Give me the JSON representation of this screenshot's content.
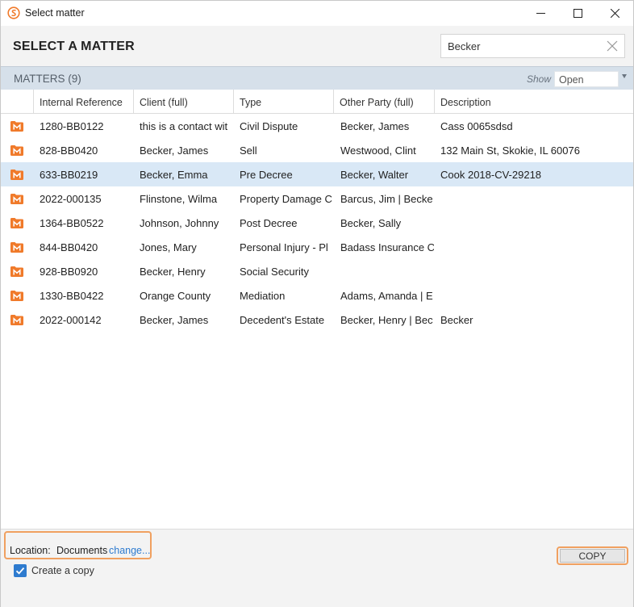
{
  "window": {
    "title": "Select matter"
  },
  "header": {
    "title": "SELECT A MATTER",
    "search_value": "Becker"
  },
  "section": {
    "label": "MATTERS (9)",
    "show_label": "Show",
    "show_value": "Open"
  },
  "table": {
    "columns": [
      "Internal Reference",
      "Client (full)",
      "Type",
      "Other Party (full)",
      "Description"
    ],
    "rows": [
      {
        "ref": "1280-BB0122",
        "client": "this is a contact wit",
        "type": "Civil Dispute",
        "other": "Becker, James",
        "desc": "Cass 0065sdsd",
        "selected": false
      },
      {
        "ref": "828-BB0420",
        "client": "Becker, James",
        "type": "Sell",
        "other": "Westwood, Clint",
        "desc": "132 Main St, Skokie, IL 60076",
        "selected": false
      },
      {
        "ref": "633-BB0219",
        "client": "Becker, Emma",
        "type": "Pre Decree",
        "other": "Becker, Walter",
        "desc": "Cook 2018-CV-29218",
        "selected": true
      },
      {
        "ref": "2022-000135",
        "client": "Flinstone, Wilma",
        "type": "Property Damage C",
        "other": "Barcus, Jim | Becke",
        "desc": "",
        "selected": false
      },
      {
        "ref": "1364-BB0522",
        "client": "Johnson, Johnny",
        "type": "Post Decree",
        "other": "Becker, Sally",
        "desc": "",
        "selected": false
      },
      {
        "ref": "844-BB0420",
        "client": "Jones, Mary",
        "type": "Personal Injury - Pl",
        "other": "Badass Insurance C",
        "desc": "",
        "selected": false
      },
      {
        "ref": "928-BB0920",
        "client": "Becker, Henry",
        "type": "Social Security",
        "other": "",
        "desc": "",
        "selected": false
      },
      {
        "ref": "1330-BB0422",
        "client": "Orange County",
        "type": "Mediation",
        "other": "Adams, Amanda | E",
        "desc": "",
        "selected": false
      },
      {
        "ref": "2022-000142",
        "client": "Becker, James",
        "type": "Decedent's Estate",
        "other": "Becker, Henry | Bec",
        "desc": "Becker",
        "selected": false
      }
    ]
  },
  "footer": {
    "location_label": "Location:",
    "location_value": "Documents",
    "change_link": "change...",
    "copy_button": "COPY",
    "checkbox_label": "Create a copy",
    "checkbox_checked": true
  },
  "colors": {
    "accent": "#2e7bcf",
    "matter_icon": "#f07a2a",
    "highlight": "#f0a060",
    "selected_row": "#d9e8f6",
    "section_bar": "#d6e0ea"
  },
  "icons": {
    "app": "app-logo-icon",
    "matter": "matter-folder-icon",
    "clear": "close-icon",
    "checkbox": "check-icon"
  }
}
